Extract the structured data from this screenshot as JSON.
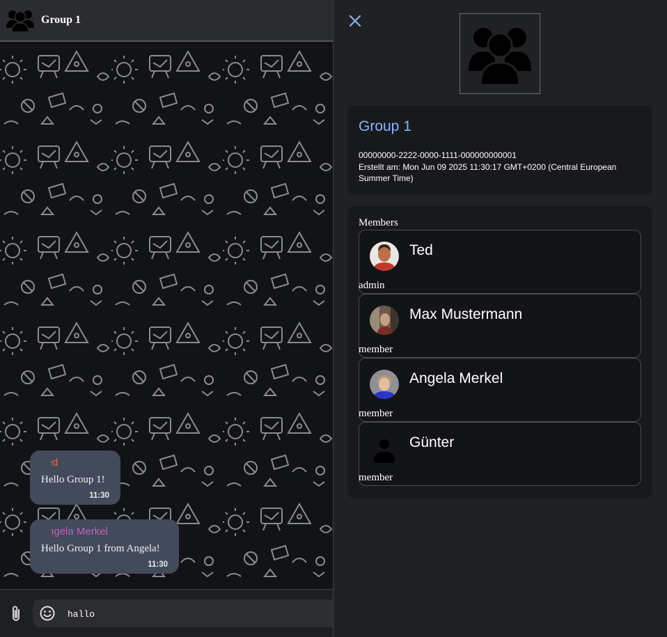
{
  "chat": {
    "title": "Group 1",
    "group_icon": "group-icon",
    "messages": [
      {
        "sender": "Ted",
        "sender_color": "#e8672f",
        "text": "Hello Group 1!",
        "time": "11:30"
      },
      {
        "sender": "Angela Merkel",
        "sender_color": "#c55fc0",
        "text": "Hello Group 1 from Angela!",
        "time": "11:30"
      }
    ],
    "composer": {
      "attach_icon": "paperclip-icon",
      "emoji_icon": "emoji-icon",
      "input_value": "hallo"
    }
  },
  "info": {
    "close_icon": "close-icon",
    "group_name": "Group 1",
    "group_id": "00000000-2222-0000-1111-000000000001",
    "created": "Erstellt am: Mon Jun 09 2025 11:30:17 GMT+0200 (Central European Summer Time)",
    "members_title": "Members",
    "members": [
      {
        "name": "Ted",
        "role": "admin",
        "avatar": "photo-avatar"
      },
      {
        "name": "Max Mustermann",
        "role": "member",
        "avatar": "photo-avatar"
      },
      {
        "name": "Angela Merkel",
        "role": "member",
        "avatar": "photo-avatar"
      },
      {
        "name": "Günter",
        "role": "member",
        "avatar": "default-person-icon"
      }
    ]
  },
  "colors": {
    "accent": "#8ab4f8",
    "bubble": "#424a5c",
    "panel": "#18191c"
  }
}
